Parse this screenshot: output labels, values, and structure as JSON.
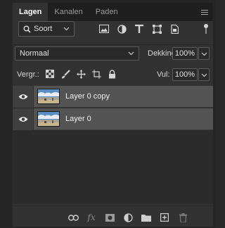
{
  "tabs": [
    {
      "label": "Lagen",
      "active": true
    },
    {
      "label": "Kanalen",
      "active": false
    },
    {
      "label": "Paden",
      "active": false
    }
  ],
  "filter": {
    "kind_label": "Soort",
    "icons": [
      "image-filter-icon",
      "adjustment-filter-icon",
      "type-filter-icon",
      "shape-filter-icon",
      "smart-object-filter-icon"
    ]
  },
  "blend": {
    "mode": "Normaal",
    "opacity_label": "Dekking:",
    "opacity_value": "100%"
  },
  "lock": {
    "label": "Vergr.:",
    "icons": [
      "lock-transparent-pixels-icon",
      "lock-image-pixels-icon",
      "lock-position-icon",
      "lock-artboard-icon",
      "lock-all-icon"
    ],
    "fill_label": "Vul:",
    "fill_value": "100%"
  },
  "layers": [
    {
      "name": "Layer 0 copy",
      "visible": true
    },
    {
      "name": "Layer 0",
      "visible": true
    }
  ],
  "footer": {
    "icons": [
      "link-layers-icon",
      "fx-icon",
      "add-mask-icon",
      "new-adjustment-layer-icon",
      "new-group-icon",
      "new-layer-icon",
      "delete-layer-icon"
    ],
    "fx_label": "fx"
  },
  "colors": {
    "panel_bg": "#323232",
    "layer_row_bg": "#535353",
    "text": "#d6d6d6"
  }
}
